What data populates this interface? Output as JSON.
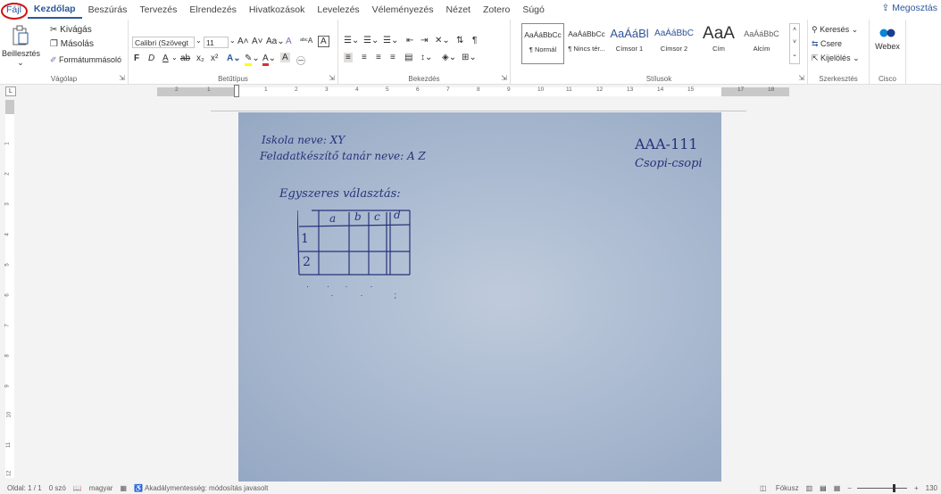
{
  "menu": {
    "tabs": [
      "Fájl",
      "Kezdőlap",
      "Beszúrás",
      "Tervezés",
      "Elrendezés",
      "Hivatkozások",
      "Levelezés",
      "Véleményezés",
      "Nézet",
      "Zotero",
      "Súgó"
    ],
    "share_label": "Megosztás"
  },
  "clipboard": {
    "paste": "Beillesztés",
    "cut": "Kivágás",
    "copy": "Másolás",
    "format_painter": "Formátummásoló",
    "group": "Vágólap"
  },
  "font": {
    "name": "Calibri (Szövegt",
    "size": "11",
    "group": "Betűtípus",
    "bold": "F",
    "italic": "D",
    "underline": "A",
    "strike": "ab",
    "subscript": "x₂",
    "superscript": "x²",
    "change_case": "Aa"
  },
  "paragraph": {
    "group": "Bekezdés"
  },
  "styles": {
    "group": "Stílusok",
    "items": [
      {
        "preview": "AaÁáBbCc",
        "name": "¶ Normál"
      },
      {
        "preview": "AaÁáBbCc",
        "name": "¶ Nincs tér..."
      },
      {
        "preview": "AaÁáBl",
        "name": "Címsor 1"
      },
      {
        "preview": "AaÁáBbC",
        "name": "Címsor 2"
      },
      {
        "preview": "AaA",
        "name": "Cím"
      },
      {
        "preview": "AaÁáBbC",
        "name": "Alcím"
      }
    ]
  },
  "editing": {
    "find": "Keresés",
    "replace": "Csere",
    "select": "Kijelölés",
    "group": "Szerkesztés"
  },
  "cisco": {
    "webex": "Webex",
    "group": "Cisco"
  },
  "ruler": {
    "h_labels": [
      "2",
      "1",
      "1",
      "2",
      "3",
      "4",
      "5",
      "6",
      "7",
      "8",
      "9",
      "10",
      "11",
      "12",
      "13",
      "14",
      "15",
      "17",
      "18"
    ],
    "v_labels": [
      "1",
      "2",
      "3",
      "4",
      "5",
      "6",
      "7",
      "8",
      "9",
      "10",
      "11",
      "12"
    ]
  },
  "document": {
    "school_line": "Iskola neve: XY",
    "author_line": "Feladatkészítő tanár neve: A Z",
    "code": "AAA-111",
    "group_label": "Csopi-csopi",
    "exercise_title": "Egyszeres választás:",
    "table_headers": [
      "a",
      "b",
      "c",
      "d"
    ],
    "table_rows": [
      "1",
      "2"
    ]
  },
  "status": {
    "page": "Oldal: 1 / 1",
    "words": "0 szó",
    "language": "magyar",
    "accessibility": "Akadálymentesség: módosítás javasolt",
    "focus": "Fókusz",
    "zoom": "130"
  }
}
